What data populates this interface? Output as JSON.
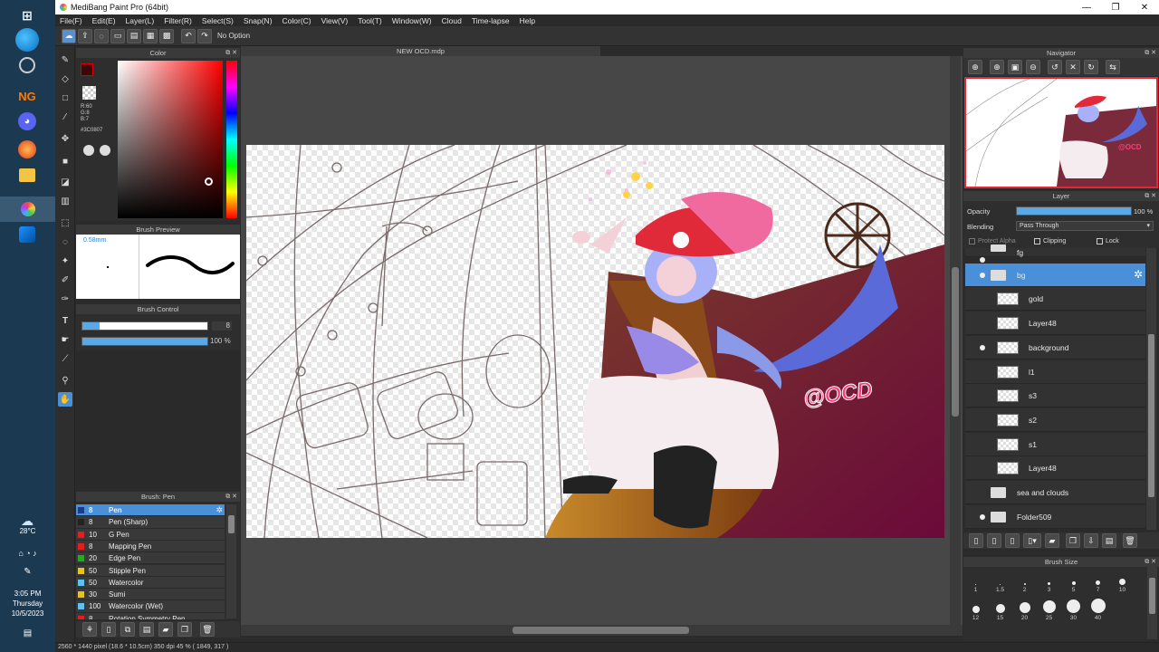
{
  "app": {
    "title": "MediBang Paint Pro (64bit)",
    "doc_tab": "NEW OCD.mdp",
    "tool_option": "No Option"
  },
  "menu": [
    "File(F)",
    "Edit(E)",
    "Layer(L)",
    "Filter(R)",
    "Select(S)",
    "Snap(N)",
    "Color(C)",
    "View(V)",
    "Tool(T)",
    "Window(W)",
    "Cloud",
    "Time-lapse",
    "Help"
  ],
  "taskbar": {
    "weather": "28°C",
    "time": "3:05 PM",
    "day": "Thursday",
    "date": "10/5/2023"
  },
  "color_panel": {
    "title": "Color",
    "r": "R:60",
    "g": "G:8",
    "b": "B:7",
    "hex": "#3C0807",
    "primary": "#3c0807",
    "secondary": "#8b0080"
  },
  "brush_preview": {
    "title": "Brush Preview",
    "size": "0.58mm"
  },
  "brush_control": {
    "title": "Brush Control",
    "size_value": "8",
    "opacity_value": "100 %"
  },
  "brush_list": {
    "title": "Brush: Pen",
    "items": [
      {
        "size": "8",
        "name": "Pen",
        "color": "#1a3a8a"
      },
      {
        "size": "8",
        "name": "Pen (Sharp)",
        "color": "#222222"
      },
      {
        "size": "10",
        "name": "G Pen",
        "color": "#e02020"
      },
      {
        "size": "8",
        "name": "Mapping Pen",
        "color": "#e02020"
      },
      {
        "size": "20",
        "name": "Edge Pen",
        "color": "#22aa22"
      },
      {
        "size": "50",
        "name": "Stipple Pen",
        "color": "#e8c020"
      },
      {
        "size": "50",
        "name": "Watercolor",
        "color": "#60c0f0"
      },
      {
        "size": "30",
        "name": "Sumi",
        "color": "#e8c020"
      },
      {
        "size": "100",
        "name": "Watercolor (Wet)",
        "color": "#60c0f0"
      },
      {
        "size": "8",
        "name": "Rotation Symmetry Pen",
        "color": "#e02020"
      }
    ]
  },
  "navigator": {
    "title": "Navigator"
  },
  "layer_panel": {
    "title": "Layer",
    "opacity_label": "Opacity",
    "opacity_value": "100 %",
    "blending_label": "Blending",
    "blending_value": "Pass Through",
    "protect_alpha": "Protect Alpha",
    "clipping": "Clipping",
    "lock": "Lock",
    "layers": [
      {
        "name": "fg",
        "type": "folder"
      },
      {
        "name": "bg",
        "type": "folder",
        "selected": true
      },
      {
        "name": "gold",
        "type": "layer"
      },
      {
        "name": "Layer48",
        "type": "layer"
      },
      {
        "name": "background",
        "type": "layer"
      },
      {
        "name": "l1",
        "type": "layer"
      },
      {
        "name": "s3",
        "type": "layer"
      },
      {
        "name": "s2",
        "type": "layer"
      },
      {
        "name": "s1",
        "type": "layer"
      },
      {
        "name": "Layer48",
        "type": "layer"
      },
      {
        "name": "sea and clouds",
        "type": "folder"
      },
      {
        "name": "Folder509",
        "type": "folder"
      }
    ]
  },
  "brush_size": {
    "title": "Brush Size",
    "labels": [
      "1",
      "1.5",
      "2",
      "3",
      "5",
      "7",
      "10",
      "12",
      "15",
      "20",
      "25",
      "30",
      "40"
    ]
  },
  "artwork": {
    "watermark": "@OCD"
  },
  "statusbar": {
    "text": "2560 * 1440 pixel  (18.6 * 10.5cm)  350 dpi  45 %  ( 1849, 317 )"
  }
}
